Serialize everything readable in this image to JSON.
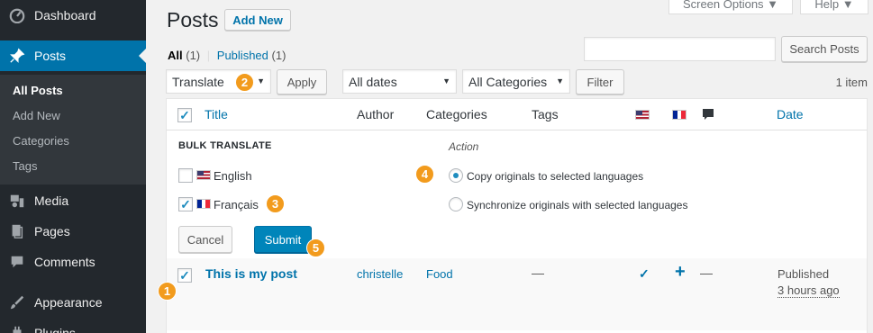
{
  "sidebar": {
    "items": [
      {
        "label": "Dashboard",
        "icon": "dashboard-icon"
      },
      {
        "label": "Posts",
        "icon": "pin-icon"
      },
      {
        "label": "Media",
        "icon": "media-icon"
      },
      {
        "label": "Pages",
        "icon": "pages-icon"
      },
      {
        "label": "Comments",
        "icon": "comments-icon"
      },
      {
        "label": "Appearance",
        "icon": "brush-icon"
      },
      {
        "label": "Plugins",
        "icon": "plugin-icon"
      }
    ],
    "submenu": [
      "All Posts",
      "Add New",
      "Categories",
      "Tags"
    ]
  },
  "header": {
    "title": "Posts",
    "add_new": "Add New",
    "screen_options": "Screen Options ▼",
    "help": "Help ▼"
  },
  "views": {
    "all": "All",
    "all_count": "(1)",
    "sep": "|",
    "published": "Published",
    "published_count": "(1)"
  },
  "search": {
    "button": "Search Posts",
    "value": ""
  },
  "filters": {
    "bulk_action": "Translate",
    "apply": "Apply",
    "dates": "All dates",
    "categories": "All Categories",
    "filter": "Filter",
    "items_count": "1 item"
  },
  "table": {
    "columns": {
      "title": "Title",
      "author": "Author",
      "categories": "Categories",
      "tags": "Tags",
      "date": "Date"
    }
  },
  "bulk_translate": {
    "title": "BULK TRANSLATE",
    "action_label": "Action",
    "languages": [
      {
        "label": "English",
        "checked": false
      },
      {
        "label": "Français",
        "checked": true
      }
    ],
    "options": [
      {
        "label": "Copy originals to selected languages",
        "selected": true
      },
      {
        "label": "Synchronize originals with selected languages",
        "selected": false
      }
    ],
    "cancel": "Cancel",
    "submit": "Submit"
  },
  "posts": [
    {
      "title": "This is my post",
      "author": "christelle",
      "category": "Food",
      "tags": "—",
      "comments": "—",
      "status": "Published",
      "date": "3 hours ago",
      "checked": true
    }
  ],
  "badges": [
    "1",
    "2",
    "3",
    "4",
    "5"
  ],
  "colors": {
    "accent": "#0073aa",
    "sidebar": "#23282d",
    "badge": "#f29b1d",
    "submit": "#0085ba"
  }
}
